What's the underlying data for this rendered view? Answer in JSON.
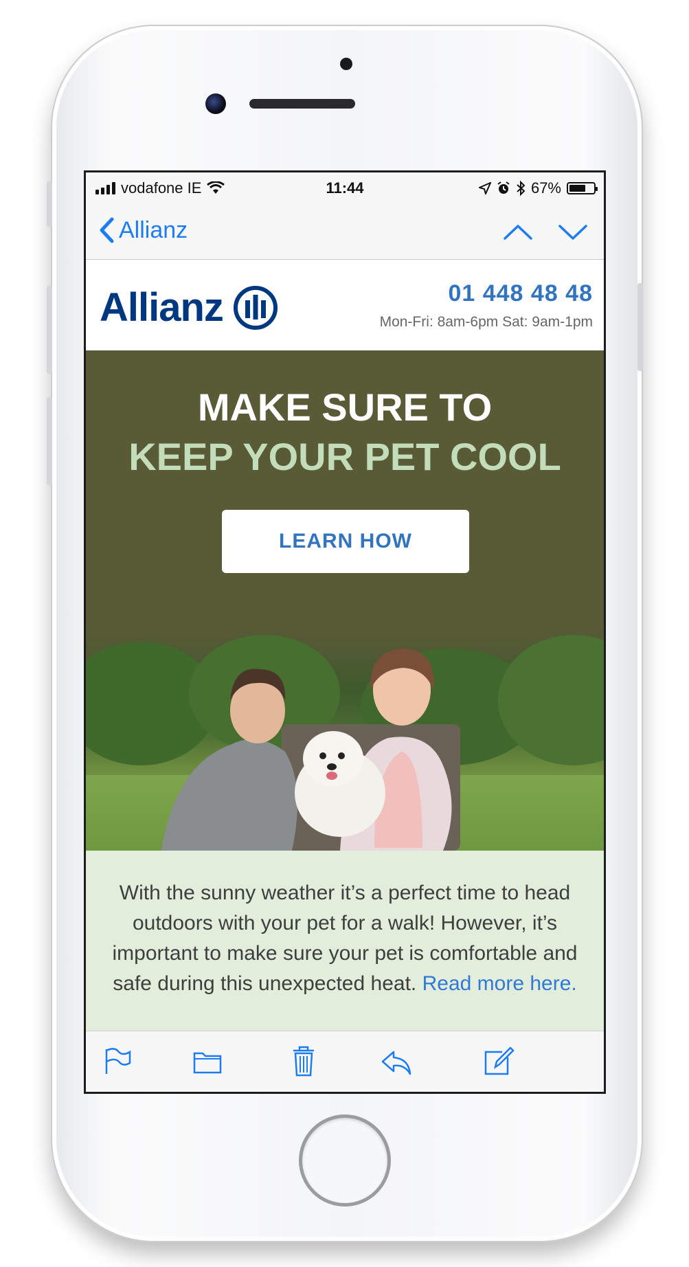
{
  "status_bar": {
    "carrier": "vodafone IE",
    "time": "11:44",
    "battery_percent": "67%",
    "battery_level": 0.67,
    "icons": [
      "signal-bars-icon",
      "wifi-icon",
      "location-arrow-icon",
      "alarm-icon",
      "bluetooth-icon",
      "battery-icon"
    ]
  },
  "nav": {
    "back_label": "Allianz",
    "accent": "#1c7cf4"
  },
  "email": {
    "brand": "Allianz",
    "phone_number": "01 448 48 48",
    "hours": "Mon-Fri: 8am-6pm Sat: 9am-1pm",
    "hero_line1": "MAKE SURE TO",
    "hero_line2": "KEEP YOUR PET COOL",
    "cta_label": "LEARN HOW",
    "body_text": "With the sunny weather it’s a perfect time to head outdoors with your pet for a walk! However, it’s important to make sure your pet is comfortable and safe during this unexpected heat.",
    "read_more": "Read more here.",
    "colors": {
      "brand_blue": "#003781",
      "link_blue": "#3274c0",
      "hero_bg": "#595a36",
      "hero_accent": "#c3dcb9",
      "body_bg": "#e2eddc"
    }
  },
  "toolbar": {
    "icons": [
      "flag-icon",
      "folder-icon",
      "trash-icon",
      "reply-icon",
      "compose-icon"
    ]
  }
}
